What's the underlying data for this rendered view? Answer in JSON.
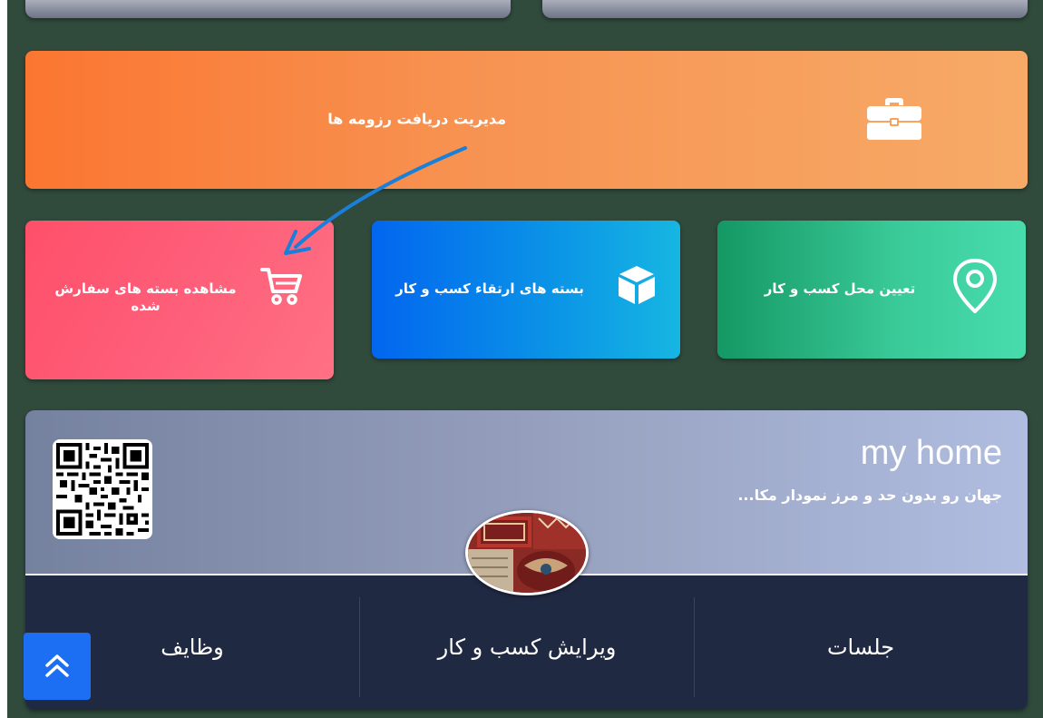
{
  "banner": {
    "title": "مدیریت دریافت رزومه ها",
    "icon": "briefcase-icon",
    "colors": [
      "#fb7631",
      "#f7aa67"
    ]
  },
  "tiles": [
    {
      "label": "تعیین محل کسب و کار",
      "icon": "location-pin-icon",
      "colors": [
        "#149864",
        "#48dcad"
      ]
    },
    {
      "label": "بسته های ارتقاء کسب و کار",
      "icon": "package-box-icon",
      "colors": [
        "#0266ef",
        "#16b6e2"
      ]
    },
    {
      "label": "مشاهده بسته های سفارش شده",
      "icon": "shopping-cart-icon",
      "colors": [
        "#ff4f6a",
        "#ff7184"
      ]
    }
  ],
  "profile": {
    "name": "my home",
    "tagline": "جهان رو بدون حد و مرز نمودار مکا...",
    "qr_icon": "qr-code-icon",
    "avatar": "carpet-shop-photo"
  },
  "bottom_nav": {
    "items": [
      "جلسات",
      "ویرایش کسب و کار",
      "وظایف"
    ]
  },
  "scroll_top": {
    "icon": "double-chevron-up-icon",
    "color": "#1c6ff2"
  },
  "annotation": {
    "color": "#1a7fd8"
  }
}
